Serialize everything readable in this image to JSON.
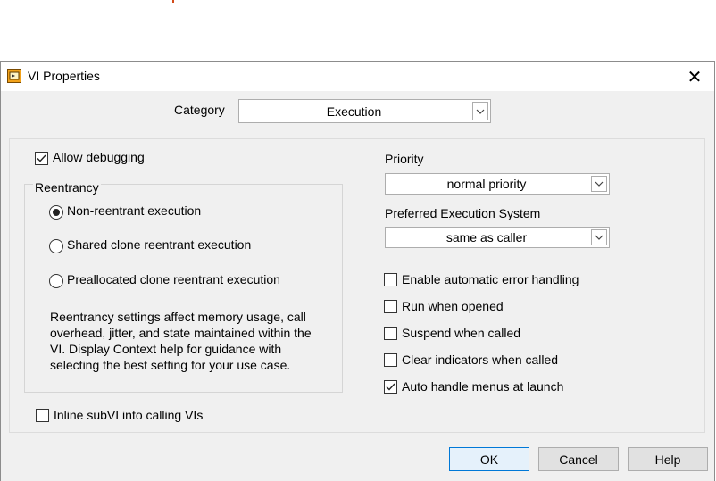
{
  "window": {
    "title": "VI Properties",
    "close": "✕"
  },
  "category": {
    "label": "Category",
    "value": "Execution"
  },
  "left": {
    "allow_debugging": {
      "label": "Allow debugging",
      "checked": true
    },
    "reentrancy": {
      "legend": "Reentrancy",
      "options": [
        {
          "label": "Non-reentrant execution",
          "selected": true
        },
        {
          "label": "Shared clone reentrant execution",
          "selected": false
        },
        {
          "label": "Preallocated clone reentrant execution",
          "selected": false
        }
      ],
      "note_lines": [
        "Reentrancy settings affect memory usage, call",
        "overhead, jitter, and state maintained within the",
        "VI. Display Context help for guidance with",
        "selecting the best setting for your use case."
      ]
    },
    "inline_subvi": {
      "label": "Inline subVI into calling VIs",
      "checked": false
    }
  },
  "right": {
    "priority": {
      "label": "Priority",
      "value": "normal priority"
    },
    "exec_system": {
      "label": "Preferred Execution System",
      "value": "same as caller"
    },
    "checkboxes": [
      {
        "label": "Enable automatic error handling",
        "checked": false
      },
      {
        "label": "Run when opened",
        "checked": false
      },
      {
        "label": "Suspend when called",
        "checked": false
      },
      {
        "label": "Clear indicators when called",
        "checked": false
      },
      {
        "label": "Auto handle menus at launch",
        "checked": true
      }
    ]
  },
  "buttons": {
    "ok": "OK",
    "cancel": "Cancel",
    "help": "Help"
  },
  "colors": {
    "dialog_bg": "#f0f0f0",
    "accent": "#0078d7"
  }
}
